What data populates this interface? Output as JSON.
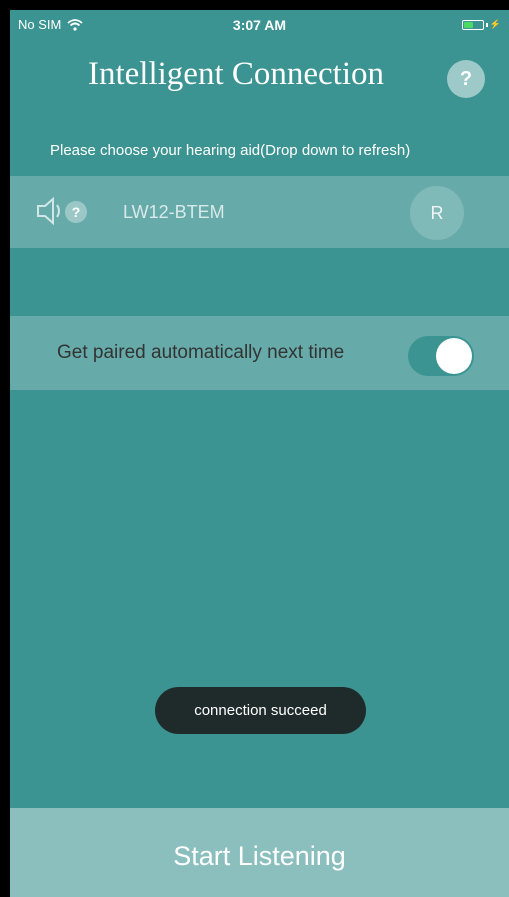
{
  "status_bar": {
    "carrier": "No SIM",
    "time": "3:07 AM"
  },
  "header": {
    "title": "Intelligent Connection",
    "help_label": "?"
  },
  "hint": "Please choose your hearing aid(Drop down to refresh)",
  "device": {
    "badge": "?",
    "name": "LW12-BTEM",
    "side": "R"
  },
  "auto_pair": {
    "label": "Get paired automatically next time",
    "enabled": true
  },
  "toast": "connection succeed",
  "footer": {
    "start_label": "Start Listening"
  },
  "colors": {
    "background": "#3b9492",
    "toast": "#1f2b2b",
    "button": "#8abfbd"
  }
}
